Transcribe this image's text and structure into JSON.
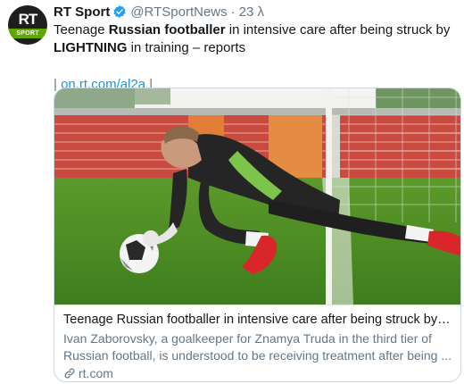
{
  "tweet": {
    "avatar_logo": "RT",
    "avatar_band": "SPORT",
    "author_name": "RT Sport",
    "handle": "@RTSportNews",
    "separator": "·",
    "time": "23 λ",
    "verified_icon": "verified-badge-icon",
    "text_parts": {
      "p1": "Teenage ",
      "p2": "Russian footballer",
      "p3": " in intensive care after being struck by ",
      "p4": "LIGHTNING",
      "p5": " in training – reports"
    },
    "link": {
      "prefix": "| ",
      "url": "on.rt.com/al2a",
      "suffix": " |"
    }
  },
  "card": {
    "title": "Teenage Russian footballer in intensive care after being struck by LIGHT...",
    "description": "Ivan Zaborovsky, a goalkeeper for Znamya Truda in the third tier of Russian football, is understood to be receiving treatment after being ...",
    "domain": "rt.com",
    "domain_icon": "link-icon"
  },
  "colors": {
    "accent": "#1b95e0",
    "muted": "#657786",
    "verified": "#1da1f2",
    "rt_green": "#5fa800"
  }
}
